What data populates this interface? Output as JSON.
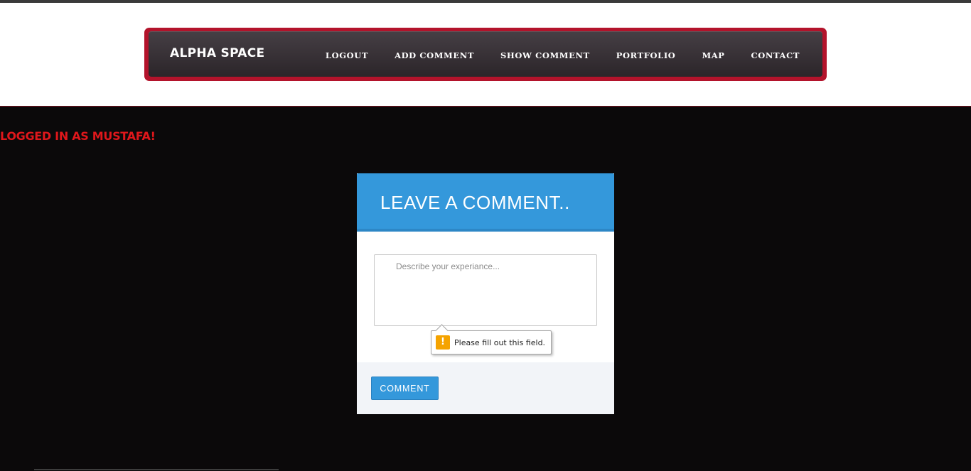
{
  "header": {
    "brand": "ALPHA SPACE",
    "nav": [
      {
        "label": "LOGOUT"
      },
      {
        "label": "ADD COMMENT"
      },
      {
        "label": "SHOW COMMENT"
      },
      {
        "label": "PORTFOLIO"
      },
      {
        "label": "MAP"
      },
      {
        "label": "CONTACT"
      }
    ]
  },
  "status": {
    "logged_in_text": "LOGGED IN AS MUSTAFA!"
  },
  "comment_form": {
    "title": "LEAVE A COMMENT..",
    "textarea_value": "",
    "textarea_placeholder": "Describe your experiance...",
    "validation_message": "Please fill out this field.",
    "validation_icon": "warning-icon",
    "validation_icon_glyph": "!",
    "submit_label": "COMMENT"
  },
  "colors": {
    "nav_border": "#b3132b",
    "nav_bg": "#3a3337",
    "page_bg": "#0b090a",
    "status_text": "#e0171b",
    "card_header": "#3498db",
    "warning": "#f5a300"
  }
}
